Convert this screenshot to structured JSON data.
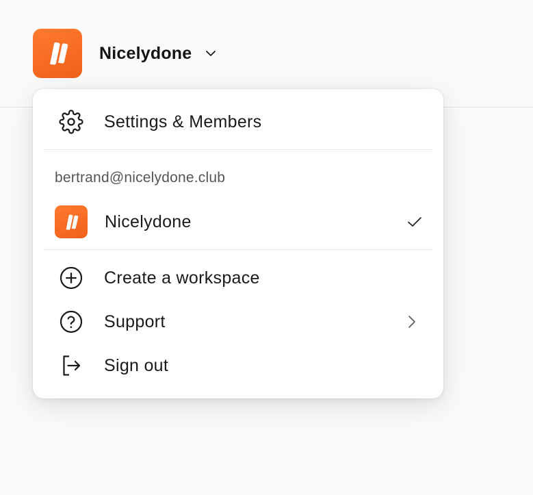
{
  "header": {
    "workspace_name": "Nicelydone",
    "logo_icon": "nicelydone-logo",
    "chevron_icon": "chevron-down-icon"
  },
  "menu": {
    "settings_label": "Settings & Members",
    "account_email": "bertrand@nicelydone.club",
    "workspaces": [
      {
        "name": "Nicelydone",
        "selected": true
      }
    ],
    "create_workspace_label": "Create a workspace",
    "support_label": "Support",
    "sign_out_label": "Sign out"
  },
  "colors": {
    "brand": "#f26a21",
    "background": "#fafafa",
    "menu_background": "#ffffff",
    "text": "#1a1a1a",
    "muted_text": "#555555"
  }
}
